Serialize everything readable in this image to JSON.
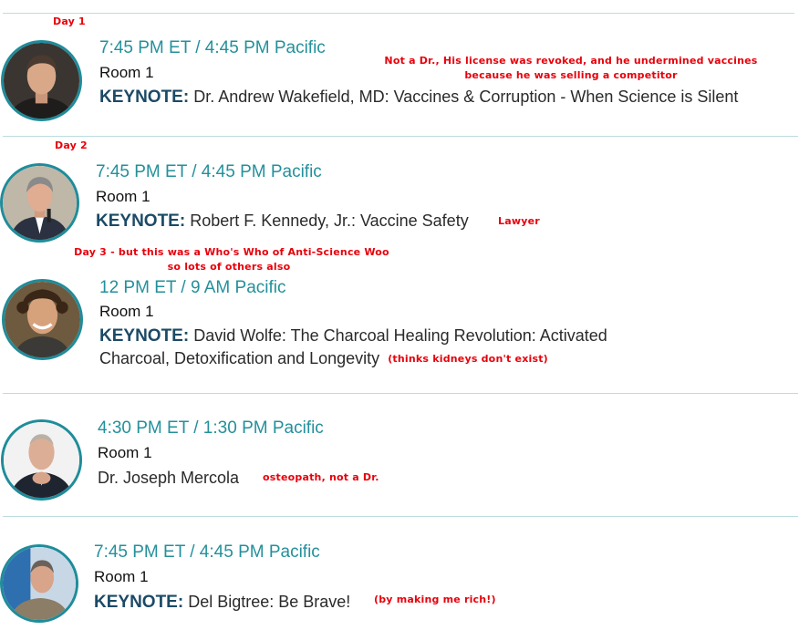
{
  "colors": {
    "time": "#23909b",
    "keynote": "#1c4a66",
    "annotation": "#e8000b",
    "divider": "#bcdde0",
    "avatar_ring": "#1f8c9a"
  },
  "sessions": [
    {
      "day_note": "Day 1",
      "time": "7:45 PM ET / 4:45 PM Pacific",
      "room": "Room 1",
      "keynote_label": "KEYNOTE:",
      "title": "Dr. Andrew Wakefield, MD: Vaccines & Corruption - When Science is Silent",
      "annotation_lines": [
        "Not a Dr., His license was revoked, and he undermined vaccines",
        "because he was selling a competitor"
      ],
      "avatar_icon": "speaker-photo"
    },
    {
      "day_note": "Day 2",
      "time": "7:45 PM ET / 4:45 PM Pacific",
      "room": "Room 1",
      "keynote_label": "KEYNOTE:",
      "title": "Robert F. Kennedy, Jr.: Vaccine Safety",
      "annotation": "Lawyer",
      "avatar_icon": "speaker-photo"
    },
    {
      "day_note_lines": [
        "Day 3 - but this was a Who's Who of Anti-Science Woo",
        "so lots of others also"
      ],
      "time": "12 PM ET / 9 AM Pacific",
      "room": "Room 1",
      "keynote_label": "KEYNOTE:",
      "title_lines": [
        "David Wolfe: The Charcoal Healing Revolution: Activated",
        "Charcoal, Detoxification and Longevity"
      ],
      "annotation": "(thinks kidneys don't exist)",
      "avatar_icon": "speaker-photo"
    },
    {
      "time": "4:30 PM ET / 1:30 PM Pacific",
      "room": "Room 1",
      "title": "Dr. Joseph Mercola",
      "annotation": "osteopath, not a Dr.",
      "avatar_icon": "speaker-photo"
    },
    {
      "time": "7:45 PM ET / 4:45 PM Pacific",
      "room": "Room 1",
      "keynote_label": "KEYNOTE:",
      "title": "Del Bigtree: Be Brave!",
      "annotation": "(by making me rich!)",
      "avatar_icon": "speaker-photo"
    }
  ]
}
